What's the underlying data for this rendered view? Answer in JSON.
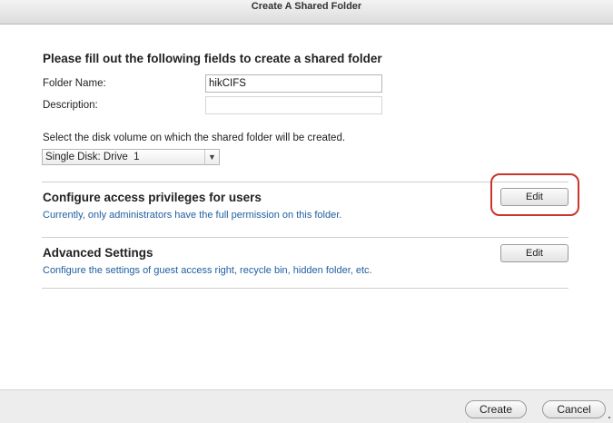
{
  "window": {
    "title": "Create A Shared Folder"
  },
  "form": {
    "heading": "Please fill out the following fields to create a shared folder",
    "folder_name_label": "Folder Name:",
    "folder_name_value": "hikCIFS",
    "description_label": "Description:",
    "description_value": "",
    "volume_prompt": "Select the disk volume on which the shared folder will be created.",
    "volume_selected": "Single Disk: Drive  1"
  },
  "sections": {
    "access": {
      "title": "Configure access privileges for users",
      "description": "Currently, only administrators have the full permission on this folder.",
      "button_label": "Edit"
    },
    "advanced": {
      "title": "Advanced Settings",
      "description": "Configure the settings of guest access right, recycle bin, hidden folder, etc.",
      "button_label": "Edit"
    }
  },
  "footer": {
    "create_label": "Create",
    "cancel_label": "Cancel"
  },
  "colors": {
    "link_blue": "#2060a0",
    "highlight_red": "#c8362c"
  }
}
